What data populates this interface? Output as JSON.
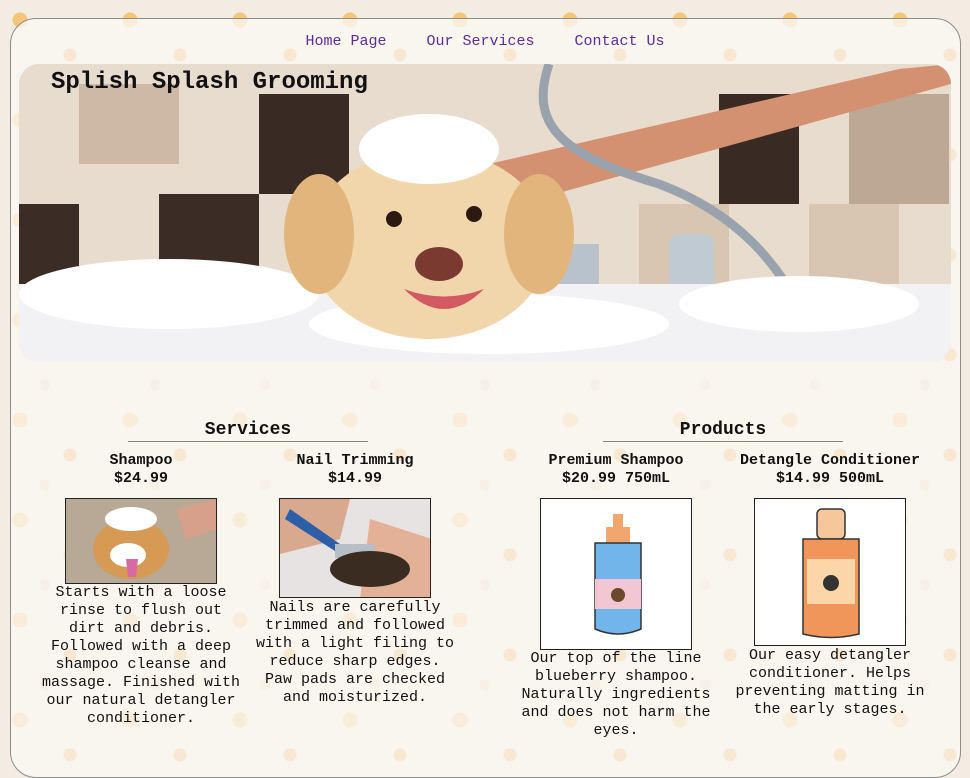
{
  "nav": {
    "home": "Home Page",
    "services": "Our Services",
    "contact": "Contact Us"
  },
  "hero": {
    "title": "Splish Splash Grooming"
  },
  "services": {
    "heading": "Services",
    "items": [
      {
        "name": "Shampoo",
        "price": "$24.99",
        "desc": "Starts with a loose rinse to flush out dirt and debris. Followed with a deep shampoo cleanse and massage. Finished with our natural detangler conditioner."
      },
      {
        "name": "Nail Trimming",
        "price": "$14.99",
        "desc": "Nails are carefully trimmed and followed with a light filing to reduce sharp edges. Paw pads are checked and moisturized."
      }
    ]
  },
  "products": {
    "heading": "Products",
    "items": [
      {
        "name": "Premium Shampoo",
        "price": "$20.99 750mL",
        "desc": "Our top of the line blueberry shampoo. Naturally ingredients and does not harm the eyes."
      },
      {
        "name": "Detangle Conditioner",
        "price": "$14.99 500mL",
        "desc": "Our easy detangler conditioner. Helps preventing matting in the early stages."
      }
    ]
  },
  "colors": {
    "nav_link": "#5e2c99",
    "shampoo_bottle": "#6fb3e8",
    "conditioner_bottle": "#f0965a"
  }
}
